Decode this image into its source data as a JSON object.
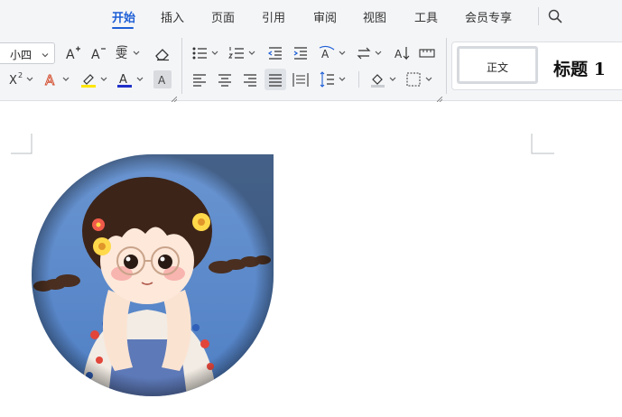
{
  "tabs": [
    {
      "label": "开始",
      "active": true
    },
    {
      "label": "插入"
    },
    {
      "label": "页面"
    },
    {
      "label": "引用"
    },
    {
      "label": "审阅"
    },
    {
      "label": "视图"
    },
    {
      "label": "工具"
    },
    {
      "label": "会员专享"
    }
  ],
  "font": {
    "size_value": "小四"
  },
  "styles": {
    "normal_label": "正文",
    "heading1_label": "标题 1"
  },
  "colors": {
    "accent": "#1d5ed6",
    "highlight": "#ffe600",
    "font_color": "#2131c9",
    "ribbon_bg": "#f4f5f7",
    "photo_bg": "#5a86c7"
  },
  "icons": {
    "search": "search-icon",
    "increase_font": "increase-font-size-icon",
    "decrease_font": "decrease-font-size-icon",
    "phonetic": "phonetic-guide-icon",
    "clear_format": "eraser-icon",
    "bullets": "bullet-list-icon",
    "numbering": "numbered-list-icon",
    "decrease_indent": "decrease-indent-icon",
    "increase_indent": "increase-indent-icon",
    "text_direction": "text-direction-icon",
    "swap": "swap-icon",
    "sort": "sort-icon",
    "tab_stops": "tab-stops-icon",
    "superscript": "superscript-icon",
    "text_effect": "text-effect-icon",
    "highlight": "highlight-icon",
    "font_color": "font-color-icon",
    "char_shading": "character-shading-icon",
    "align_left": "align-left-icon",
    "align_center": "align-center-icon",
    "align_right": "align-right-icon",
    "justify": "justify-icon",
    "distributed": "distributed-icon",
    "line_spacing": "line-spacing-icon",
    "shading": "paragraph-shading-icon",
    "borders": "borders-icon"
  }
}
